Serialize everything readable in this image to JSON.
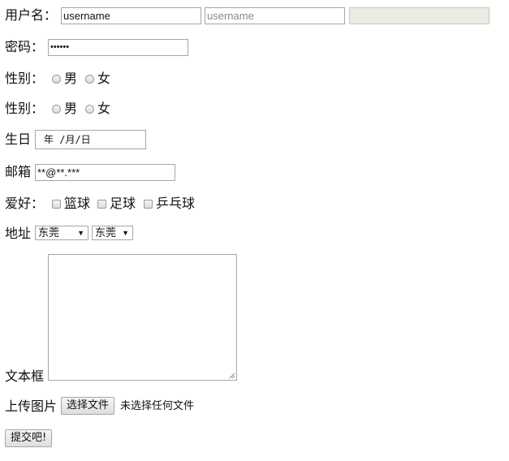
{
  "form": {
    "username": {
      "label": "用户名：",
      "value": "username",
      "placeholder": "username",
      "disabled_value": ""
    },
    "password": {
      "label": "密码：",
      "masked_value": "••••••"
    },
    "gender1": {
      "label": "性别：",
      "options": [
        "男",
        "女"
      ]
    },
    "gender2": {
      "label": "性别：",
      "options": [
        "男",
        "女"
      ]
    },
    "birthday": {
      "label": "生日",
      "value": "年 /月/日"
    },
    "email": {
      "label": "邮箱",
      "value": "**@**.***"
    },
    "hobbies": {
      "label": "爱好：",
      "options": [
        "篮球",
        "足球",
        "乒乓球"
      ]
    },
    "address": {
      "label": "地址",
      "select1": "东莞",
      "select2": "东莞"
    },
    "textarea": {
      "label": "文本框"
    },
    "upload": {
      "label": "上传图片",
      "button": "选择文件",
      "status": "未选择任何文件"
    },
    "submit": {
      "label": "提交吧!"
    }
  },
  "colors": {
    "border": "#a6a6a6",
    "disabled_bg": "#ebebe4",
    "placeholder": "#8a8a8a"
  }
}
